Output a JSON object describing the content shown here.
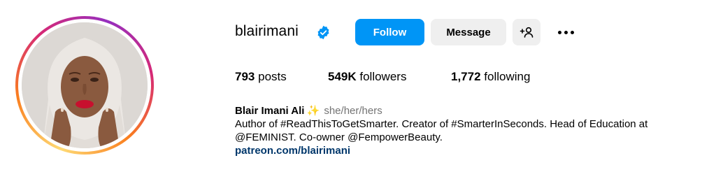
{
  "profile": {
    "username": "blairimani",
    "verified": true,
    "buttons": {
      "follow": "Follow",
      "message": "Message"
    },
    "stats": {
      "posts_count": "793",
      "posts_label": "posts",
      "followers_count": "549K",
      "followers_label": "followers",
      "following_count": "1,772",
      "following_label": "following"
    },
    "bio": {
      "full_name": "Blair Imani Ali",
      "sparkle": "✨",
      "pronouns": "she/her/hers",
      "line1": "Author of #ReadThisToGetSmarter. Creator of #SmarterInSeconds. Head of Education at",
      "line2": "@FEMINIST. Co-owner @FempowerBeauty.",
      "link": "patreon.com/blairimani"
    }
  },
  "icons": {
    "verified": "verified-badge-icon",
    "suggest": "add-person-icon",
    "more": "more-options-icon"
  },
  "colors": {
    "follow_button": "#0095f6",
    "secondary_button": "#efefef",
    "verified_badge": "#0095f6",
    "link": "#00376b",
    "pronouns": "#737373"
  }
}
